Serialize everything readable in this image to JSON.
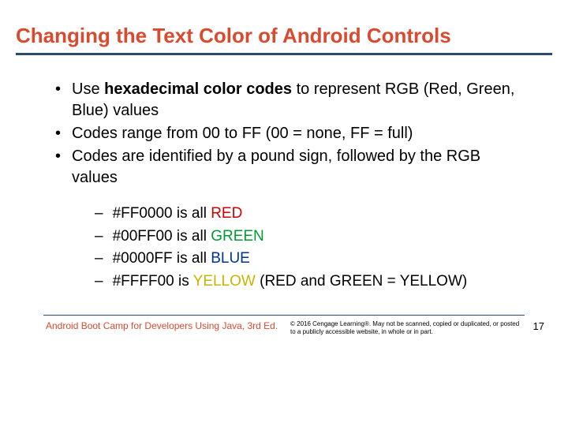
{
  "title": "Changing the Text Color of Android Controls",
  "bullets": [
    {
      "pre": "Use ",
      "bold": "hexadecimal color codes",
      "post": " to represent RGB (Red, Green, Blue) values"
    },
    {
      "pre": "Codes range from 00 to FF  (00 = none, FF = full)",
      "bold": "",
      "post": ""
    },
    {
      "pre": "Codes are identified by a pound sign, followed by the RGB values",
      "bold": "",
      "post": ""
    }
  ],
  "subs": [
    {
      "code": "#FF0000",
      "mid": " is all ",
      "word": "RED",
      "cls": "red",
      "tail": ""
    },
    {
      "code": "#00FF00",
      "mid": " is all ",
      "word": "GREEN",
      "cls": "green",
      "tail": ""
    },
    {
      "code": "#0000FF",
      "mid": " is all ",
      "word": "BLUE",
      "cls": "blue",
      "tail": ""
    },
    {
      "code": "#FFFF00",
      "mid": " is ",
      "word": "YELLOW",
      "cls": "yellow",
      "tail": " (RED and GREEN = YELLOW)"
    }
  ],
  "footer": {
    "source": "Android Boot Camp for Developers Using Java, 3rd Ed.",
    "copyright": "© 2016 Cengage Learning®. May not be scanned, copied or duplicated, or posted to a publicly accessible website, in whole or in part.",
    "page": "17"
  }
}
